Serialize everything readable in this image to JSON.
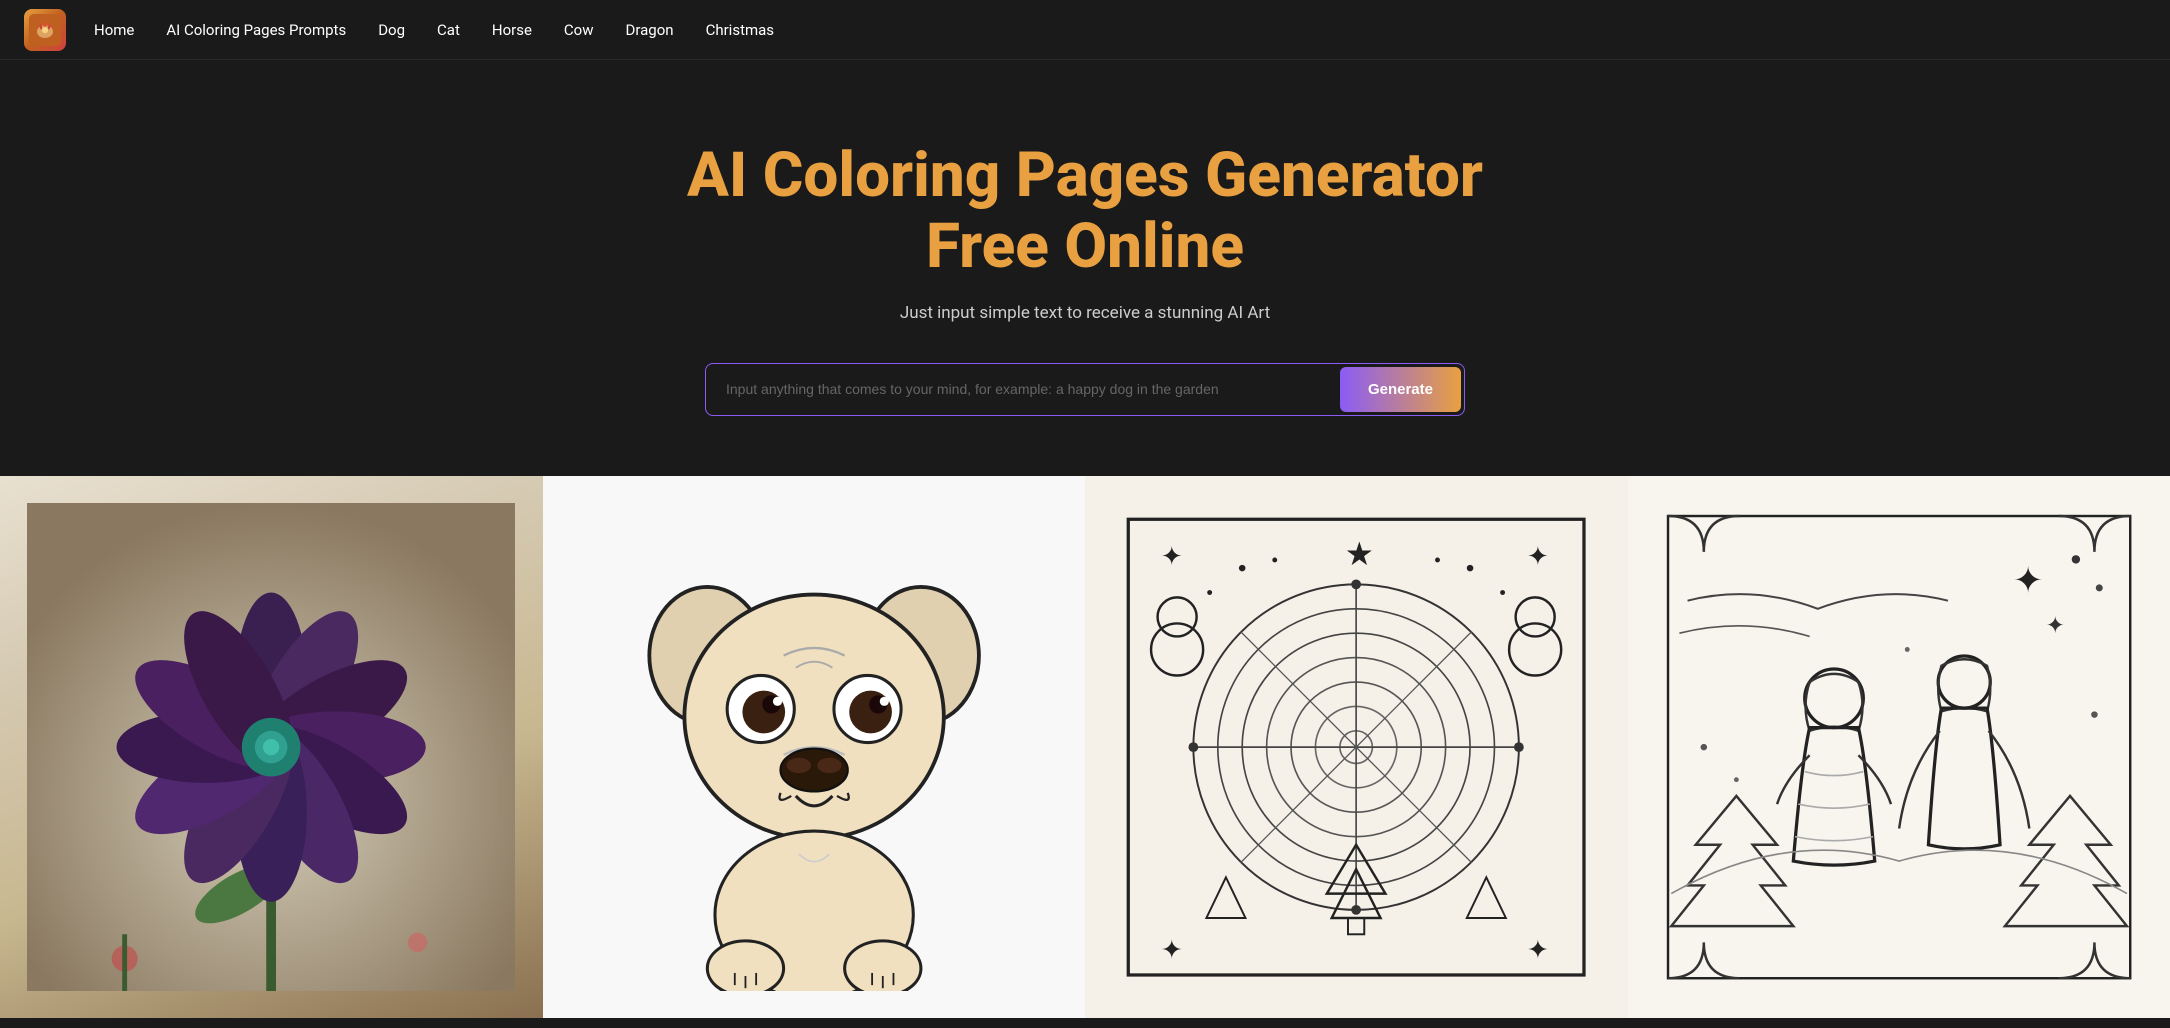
{
  "nav": {
    "logo_alt": "AI Coloring Pages Logo",
    "links": [
      {
        "label": "Home",
        "href": "#"
      },
      {
        "label": "AI Coloring Pages Prompts",
        "href": "#"
      },
      {
        "label": "Dog",
        "href": "#"
      },
      {
        "label": "Cat",
        "href": "#"
      },
      {
        "label": "Horse",
        "href": "#"
      },
      {
        "label": "Cow",
        "href": "#"
      },
      {
        "label": "Dragon",
        "href": "#"
      },
      {
        "label": "Christmas",
        "href": "#"
      }
    ]
  },
  "hero": {
    "title_line1": "AI Coloring Pages Generator",
    "title_line2": "Free Online",
    "subtitle": "Just input simple text to receive a stunning AI Art",
    "input_placeholder": "Input anything that comes to your mind, for example: a happy dog in the garden",
    "generate_button": "Generate"
  },
  "gallery": {
    "items": [
      {
        "id": 1,
        "alt": "Dark lotus flower coloring art"
      },
      {
        "id": 2,
        "alt": "Cute pug puppy coloring page"
      },
      {
        "id": 3,
        "alt": "Christmas mandala coloring page"
      },
      {
        "id": 4,
        "alt": "Angel figure coloring page"
      }
    ]
  },
  "colors": {
    "accent_orange": "#e8a040",
    "accent_purple": "#8b5cf6",
    "background": "#1a1a1a",
    "nav_border": "#2a2a2a"
  }
}
